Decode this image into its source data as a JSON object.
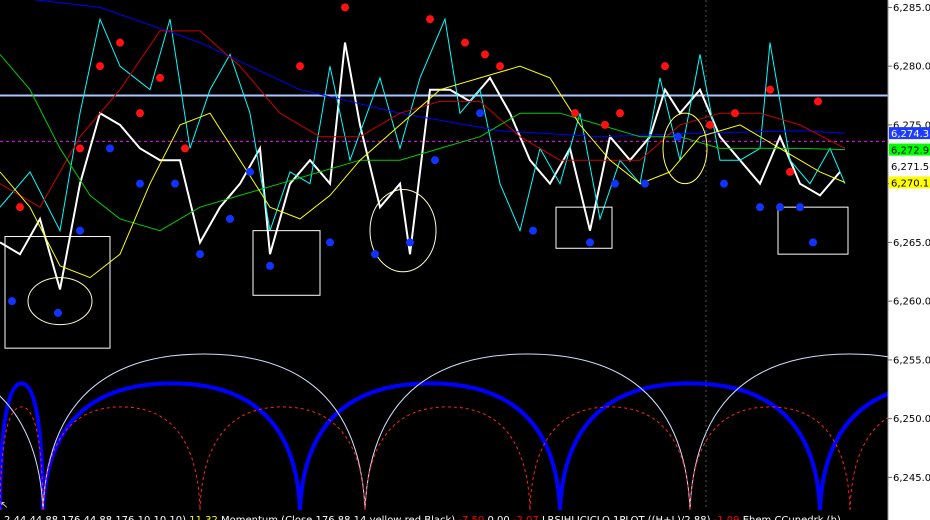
{
  "chart_data": {
    "type": "line",
    "ylim": [
      6243.5,
      6286
    ],
    "y_ticks": [
      {
        "value": 6245,
        "label": "6,245.0"
      },
      {
        "value": 6250,
        "label": "6,250.0"
      },
      {
        "value": 6255,
        "label": "6,255.0"
      },
      {
        "value": 6260,
        "label": "6,260.0"
      },
      {
        "value": 6265,
        "label": "6,265.0"
      },
      {
        "value": 6270,
        "label": "6,270.0"
      },
      {
        "value": 6275,
        "label": "6,275.0"
      },
      {
        "value": 6280,
        "label": "6,280.0"
      },
      {
        "value": 6285,
        "label": "6,285.0"
      }
    ],
    "price_tags": [
      {
        "value": 6274.3,
        "label": "6,274.3",
        "bg": "#1e3cff",
        "fg": "#ffffff"
      },
      {
        "value": 6272.9,
        "label": "6,272.9",
        "bg": "#00ff00",
        "fg": "#000000"
      },
      {
        "value": 6271.5,
        "label": "6,271.5",
        "bg": "#ffffff",
        "fg": "#000000"
      },
      {
        "value": 6270.1,
        "label": "6,270.1",
        "bg": "#ffff00",
        "fg": "#000000"
      }
    ],
    "hlines": [
      {
        "value": 6277.5,
        "color": "#a8c8ff",
        "style": "solid"
      },
      {
        "value": 6273.6,
        "color": "#ff00ff",
        "style": "dashed"
      }
    ],
    "series": [
      {
        "color": "#ffffff",
        "points": [
          [
            0,
            6265
          ],
          [
            20,
            6264
          ],
          [
            40,
            6267
          ],
          [
            60,
            6261
          ],
          [
            80,
            6270
          ],
          [
            100,
            6276
          ],
          [
            120,
            6275
          ],
          [
            140,
            6273
          ],
          [
            160,
            6272
          ],
          [
            180,
            6272
          ],
          [
            200,
            6265
          ],
          [
            220,
            6268
          ],
          [
            240,
            6270
          ],
          [
            260,
            6273
          ],
          [
            270,
            6264
          ],
          [
            290,
            6270
          ],
          [
            310,
            6272
          ],
          [
            330,
            6270
          ],
          [
            345,
            6282
          ],
          [
            360,
            6275
          ],
          [
            380,
            6268
          ],
          [
            400,
            6270
          ],
          [
            410,
            6264
          ],
          [
            430,
            6278
          ],
          [
            450,
            6278
          ],
          [
            470,
            6277
          ],
          [
            490,
            6279
          ],
          [
            510,
            6276
          ],
          [
            530,
            6272
          ],
          [
            550,
            6270
          ],
          [
            570,
            6273
          ],
          [
            590,
            6266
          ],
          [
            610,
            6274
          ],
          [
            630,
            6272
          ],
          [
            650,
            6274
          ],
          [
            665,
            6278
          ],
          [
            680,
            6276
          ],
          [
            700,
            6278
          ],
          [
            720,
            6274
          ],
          [
            740,
            6272
          ],
          [
            760,
            6270
          ],
          [
            780,
            6274
          ],
          [
            800,
            6270
          ],
          [
            820,
            6269
          ],
          [
            840,
            6271
          ]
        ]
      },
      {
        "color": "#00ffff",
        "points": [
          [
            0,
            6268
          ],
          [
            30,
            6271
          ],
          [
            60,
            6266
          ],
          [
            80,
            6276
          ],
          [
            100,
            6284
          ],
          [
            120,
            6280
          ],
          [
            150,
            6278
          ],
          [
            170,
            6284
          ],
          [
            190,
            6273
          ],
          [
            210,
            6278
          ],
          [
            230,
            6281
          ],
          [
            250,
            6276
          ],
          [
            270,
            6266
          ],
          [
            290,
            6271
          ],
          [
            310,
            6270
          ],
          [
            330,
            6280
          ],
          [
            350,
            6272
          ],
          [
            380,
            6279
          ],
          [
            400,
            6273
          ],
          [
            420,
            6279
          ],
          [
            445,
            6284
          ],
          [
            460,
            6276
          ],
          [
            480,
            6278
          ],
          [
            500,
            6270
          ],
          [
            520,
            6266
          ],
          [
            540,
            6273
          ],
          [
            560,
            6270
          ],
          [
            580,
            6276
          ],
          [
            600,
            6267
          ],
          [
            620,
            6272
          ],
          [
            640,
            6270
          ],
          [
            660,
            6279
          ],
          [
            680,
            6272
          ],
          [
            700,
            6281
          ],
          [
            720,
            6272
          ],
          [
            740,
            6272
          ],
          [
            760,
            6273
          ],
          [
            770,
            6282
          ],
          [
            790,
            6272
          ],
          [
            810,
            6270
          ],
          [
            830,
            6273
          ],
          [
            845,
            6270
          ]
        ]
      },
      {
        "color": "#0000ff",
        "points": [
          [
            0,
            6286
          ],
          [
            100,
            6285
          ],
          [
            200,
            6282
          ],
          [
            300,
            6278
          ],
          [
            400,
            6276
          ],
          [
            500,
            6274.5
          ],
          [
            600,
            6274
          ],
          [
            700,
            6274.3
          ],
          [
            800,
            6274.5
          ],
          [
            845,
            6274.3
          ]
        ]
      },
      {
        "color": "#cc0000",
        "points": [
          [
            0,
            6270
          ],
          [
            40,
            6268
          ],
          [
            80,
            6274
          ],
          [
            120,
            6278
          ],
          [
            160,
            6283
          ],
          [
            200,
            6283
          ],
          [
            240,
            6280
          ],
          [
            280,
            6276
          ],
          [
            320,
            6274
          ],
          [
            360,
            6274
          ],
          [
            400,
            6276
          ],
          [
            440,
            6277
          ],
          [
            480,
            6277
          ],
          [
            520,
            6274
          ],
          [
            560,
            6272
          ],
          [
            600,
            6272
          ],
          [
            640,
            6272
          ],
          [
            680,
            6275
          ],
          [
            720,
            6276
          ],
          [
            760,
            6276
          ],
          [
            800,
            6275
          ],
          [
            845,
            6273
          ]
        ]
      },
      {
        "color": "#00cc00",
        "points": [
          [
            0,
            6281
          ],
          [
            30,
            6278
          ],
          [
            60,
            6273
          ],
          [
            90,
            6269
          ],
          [
            120,
            6267
          ],
          [
            160,
            6266
          ],
          [
            200,
            6268
          ],
          [
            240,
            6269
          ],
          [
            280,
            6270
          ],
          [
            320,
            6271
          ],
          [
            360,
            6272
          ],
          [
            400,
            6272
          ],
          [
            440,
            6273
          ],
          [
            480,
            6274
          ],
          [
            520,
            6276
          ],
          [
            560,
            6276
          ],
          [
            600,
            6275
          ],
          [
            640,
            6274
          ],
          [
            680,
            6274
          ],
          [
            720,
            6273
          ],
          [
            760,
            6273
          ],
          [
            800,
            6273
          ],
          [
            845,
            6272.9
          ]
        ]
      },
      {
        "color": "#ffff00",
        "points": [
          [
            0,
            6271
          ],
          [
            30,
            6268
          ],
          [
            60,
            6263
          ],
          [
            90,
            6262
          ],
          [
            120,
            6264
          ],
          [
            150,
            6270
          ],
          [
            180,
            6275
          ],
          [
            210,
            6276
          ],
          [
            240,
            6272
          ],
          [
            270,
            6268
          ],
          [
            300,
            6267
          ],
          [
            330,
            6269
          ],
          [
            360,
            6272
          ],
          [
            400,
            6275
          ],
          [
            440,
            6278
          ],
          [
            480,
            6279
          ],
          [
            520,
            6280
          ],
          [
            550,
            6279
          ],
          [
            580,
            6275
          ],
          [
            610,
            6272
          ],
          [
            640,
            6270
          ],
          [
            670,
            6271
          ],
          [
            700,
            6274
          ],
          [
            740,
            6275
          ],
          [
            780,
            6273
          ],
          [
            820,
            6271
          ],
          [
            845,
            6270.1
          ]
        ]
      }
    ],
    "cycles": [
      {
        "color": "#0000ff",
        "width": 4,
        "dash": "",
        "arches": [
          [
            0,
            43,
            6253
          ],
          [
            43,
            300,
            6253
          ],
          [
            300,
            560,
            6253
          ],
          [
            560,
            820,
            6253
          ],
          [
            820,
            1080,
            6253
          ]
        ]
      },
      {
        "color": "#ccddff",
        "width": 1,
        "dash": "",
        "arches": [
          [
            -300,
            43,
            6255.5
          ],
          [
            43,
            365,
            6255.5
          ],
          [
            365,
            690,
            6255.5
          ],
          [
            690,
            1010,
            6255.5
          ]
        ]
      },
      {
        "color": "#ff2222",
        "width": 1,
        "dash": "3,3",
        "arches": [
          [
            0,
            43,
            6251
          ],
          [
            43,
            200,
            6251
          ],
          [
            200,
            365,
            6251
          ],
          [
            365,
            530,
            6251
          ],
          [
            530,
            690,
            6251
          ],
          [
            690,
            850,
            6251
          ],
          [
            850,
            1010,
            6251
          ]
        ]
      }
    ],
    "red_dots": [
      [
        20,
        6268
      ],
      [
        80,
        6273
      ],
      [
        100,
        6280
      ],
      [
        120,
        6282
      ],
      [
        140,
        6276
      ],
      [
        160,
        6279
      ],
      [
        185,
        6273
      ],
      [
        300,
        6280
      ],
      [
        345,
        6285
      ],
      [
        430,
        6284
      ],
      [
        465,
        6282
      ],
      [
        485,
        6281
      ],
      [
        500,
        6280
      ],
      [
        575,
        6276
      ],
      [
        605,
        6275
      ],
      [
        620,
        6276
      ],
      [
        665,
        6280
      ],
      [
        710,
        6275
      ],
      [
        735,
        6276
      ],
      [
        770,
        6278
      ],
      [
        790,
        6271
      ],
      [
        818,
        6277
      ]
    ],
    "blue_dots": [
      [
        12,
        6260
      ],
      [
        58,
        6259
      ],
      [
        80,
        6266
      ],
      [
        110,
        6273
      ],
      [
        140,
        6270
      ],
      [
        175,
        6270
      ],
      [
        200,
        6264
      ],
      [
        230,
        6267
      ],
      [
        250,
        6271
      ],
      [
        270,
        6263
      ],
      [
        330,
        6265
      ],
      [
        375,
        6264
      ],
      [
        410,
        6265
      ],
      [
        435,
        6272
      ],
      [
        480,
        6276
      ],
      [
        533,
        6266
      ],
      [
        590,
        6265
      ],
      [
        615,
        6270
      ],
      [
        645,
        6270
      ],
      [
        678,
        6274
      ],
      [
        724,
        6270
      ],
      [
        760,
        6268
      ],
      [
        780,
        6268
      ],
      [
        800,
        6268
      ],
      [
        813,
        6265
      ]
    ],
    "rects": [
      [
        5,
        6265.5,
        110,
        6256
      ],
      [
        253,
        6266,
        320,
        6260.5
      ],
      [
        556,
        6268,
        612,
        6264.5
      ],
      [
        778,
        6268,
        848,
        6264
      ]
    ],
    "ellipses": [
      [
        60,
        6260,
        32,
        6262
      ],
      [
        403,
        6266,
        33,
        6262.5
      ],
      [
        685,
        6273,
        22,
        6270
      ]
    ],
    "vline_x": 706,
    "status_segments": [
      {
        "text": "2.44 44.88 176.44 88 176.10 10 10)",
        "color": "#ffffff"
      },
      {
        "text": "11.32",
        "color": "#ffff00"
      },
      {
        "text": "Momentum (Close,176,88,14,yellow,red,Black)",
        "color": "#ffffff"
      },
      {
        "text": "-7.50",
        "color": "#ff0000"
      },
      {
        "text": "0.00",
        "color": "#ffffff"
      },
      {
        "text": "-2.07",
        "color": "#ff0000"
      },
      {
        "text": "LRSIHLICICLO 1PLOT ((H+L)/2,88)",
        "color": "#ffffff"
      },
      {
        "text": "-1.09",
        "color": "#ff0000"
      },
      {
        "text": "Ehem CCunedrk (h)",
        "color": "#ffffff"
      }
    ]
  }
}
